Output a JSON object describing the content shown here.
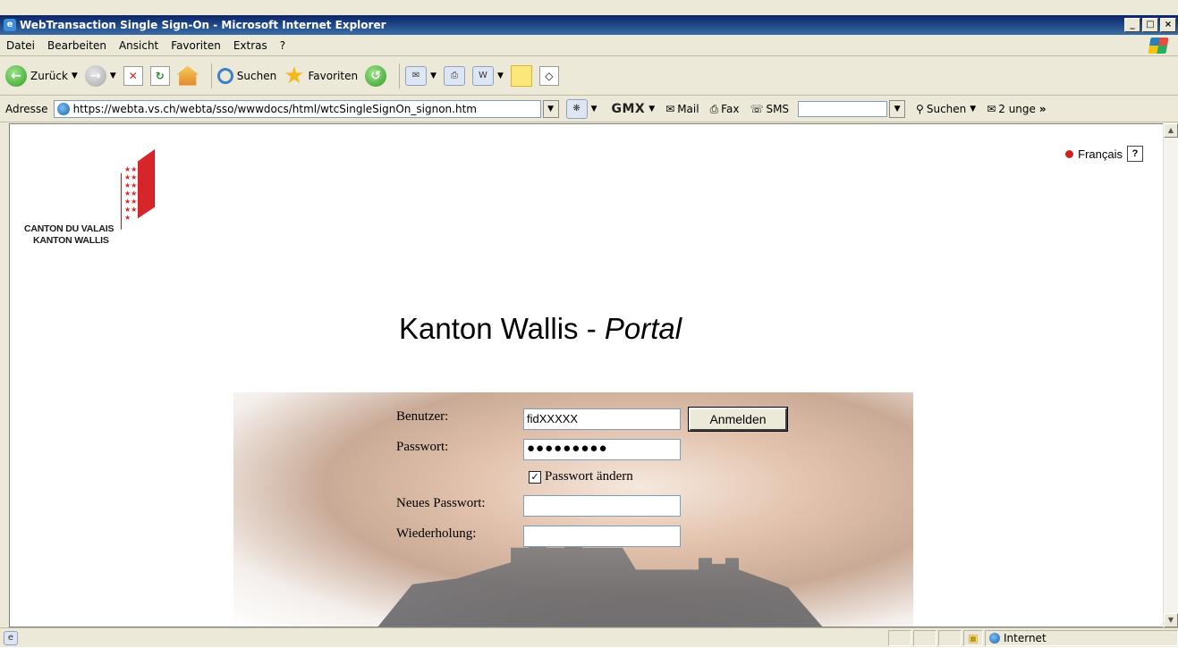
{
  "window": {
    "title": "WebTransaction Single Sign-On - Microsoft Internet Explorer",
    "controls": [
      "_",
      "□",
      "×"
    ]
  },
  "menu": [
    "Datei",
    "Bearbeiten",
    "Ansicht",
    "Favoriten",
    "Extras",
    "?"
  ],
  "toolbar": {
    "back": "Zurück",
    "search": "Suchen",
    "favorites": "Favoriten"
  },
  "address": {
    "label": "Adresse",
    "url": "https://webta.vs.ch/webta/sso/wwwdocs/html/wtcSingleSignOn_signon.htm"
  },
  "gmx": {
    "brand": "GMX",
    "mail": "Mail",
    "fax": "Fax",
    "sms": "SMS",
    "search": "Suchen",
    "unread": "2 unge"
  },
  "page": {
    "logo_line1": "CANTON DU VALAIS",
    "logo_line2": "KANTON WALLIS",
    "language": "Français",
    "help": "?",
    "headline": "Kanton Wallis - ",
    "headline_italic": "Portal",
    "form": {
      "user_label": "Benutzer:",
      "user_value": "fidXXXXX",
      "password_label": "Passwort:",
      "password_value": "●●●●●●●●●",
      "login_button": "Anmelden",
      "change_password_label": "Passwort ändern",
      "change_password_checked": true,
      "new_password_label": "Neues Passwort:",
      "repeat_label": "Wiederholung:"
    }
  },
  "status": {
    "zone": "Internet"
  }
}
